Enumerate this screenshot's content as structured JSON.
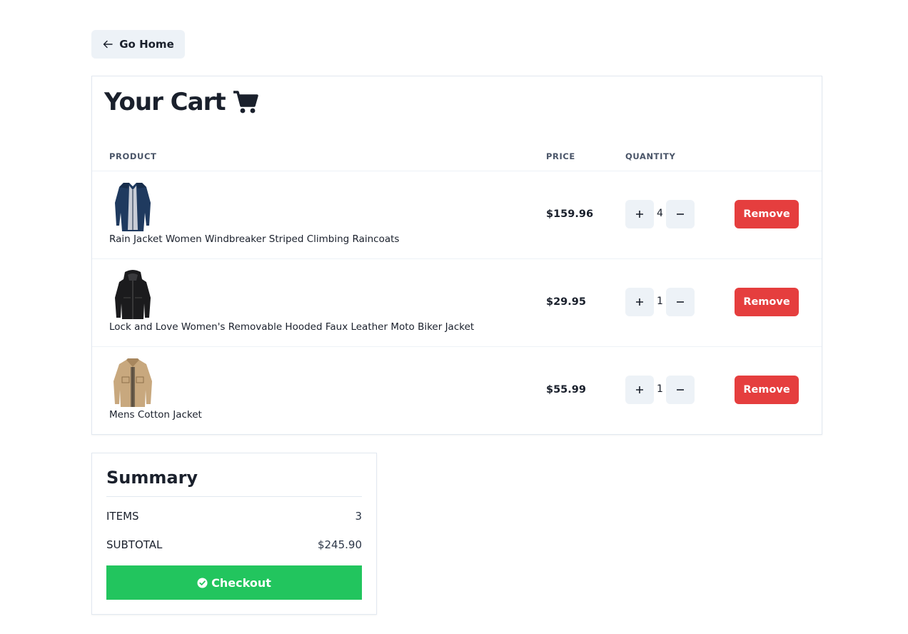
{
  "nav": {
    "home_label": "Go Home",
    "home_icon": "arrow-left-icon"
  },
  "cart": {
    "title": "Your Cart",
    "title_icon": "shopping-cart-icon",
    "columns": {
      "product": "PRODUCT",
      "price": "PRICE",
      "quantity": "QUANTITY"
    },
    "items": [
      {
        "name": "Rain Jacket Women Windbreaker Striped Climbing Raincoats",
        "price": "$159.96",
        "quantity": "4",
        "remove_label": "Remove",
        "image": "navy-raincoat-image"
      },
      {
        "name": "Lock and Love Women's Removable Hooded Faux Leather Moto Biker Jacket",
        "price": "$29.95",
        "quantity": "1",
        "remove_label": "Remove",
        "image": "black-leather-jacket-image"
      },
      {
        "name": "Mens Cotton Jacket",
        "price": "$55.99",
        "quantity": "1",
        "remove_label": "Remove",
        "image": "khaki-cotton-jacket-image"
      }
    ]
  },
  "summary": {
    "title": "Summary",
    "items_label": "ITEMS",
    "items_value": "3",
    "subtotal_label": "SUBTOTAL",
    "subtotal_value": "$245.90",
    "checkout_label": "Checkout",
    "checkout_icon": "check-circle-icon"
  },
  "colors": {
    "remove": "#e53e3e",
    "checkout": "#22c55e",
    "muted_button": "#edf2f7",
    "text": "#1a202c"
  }
}
